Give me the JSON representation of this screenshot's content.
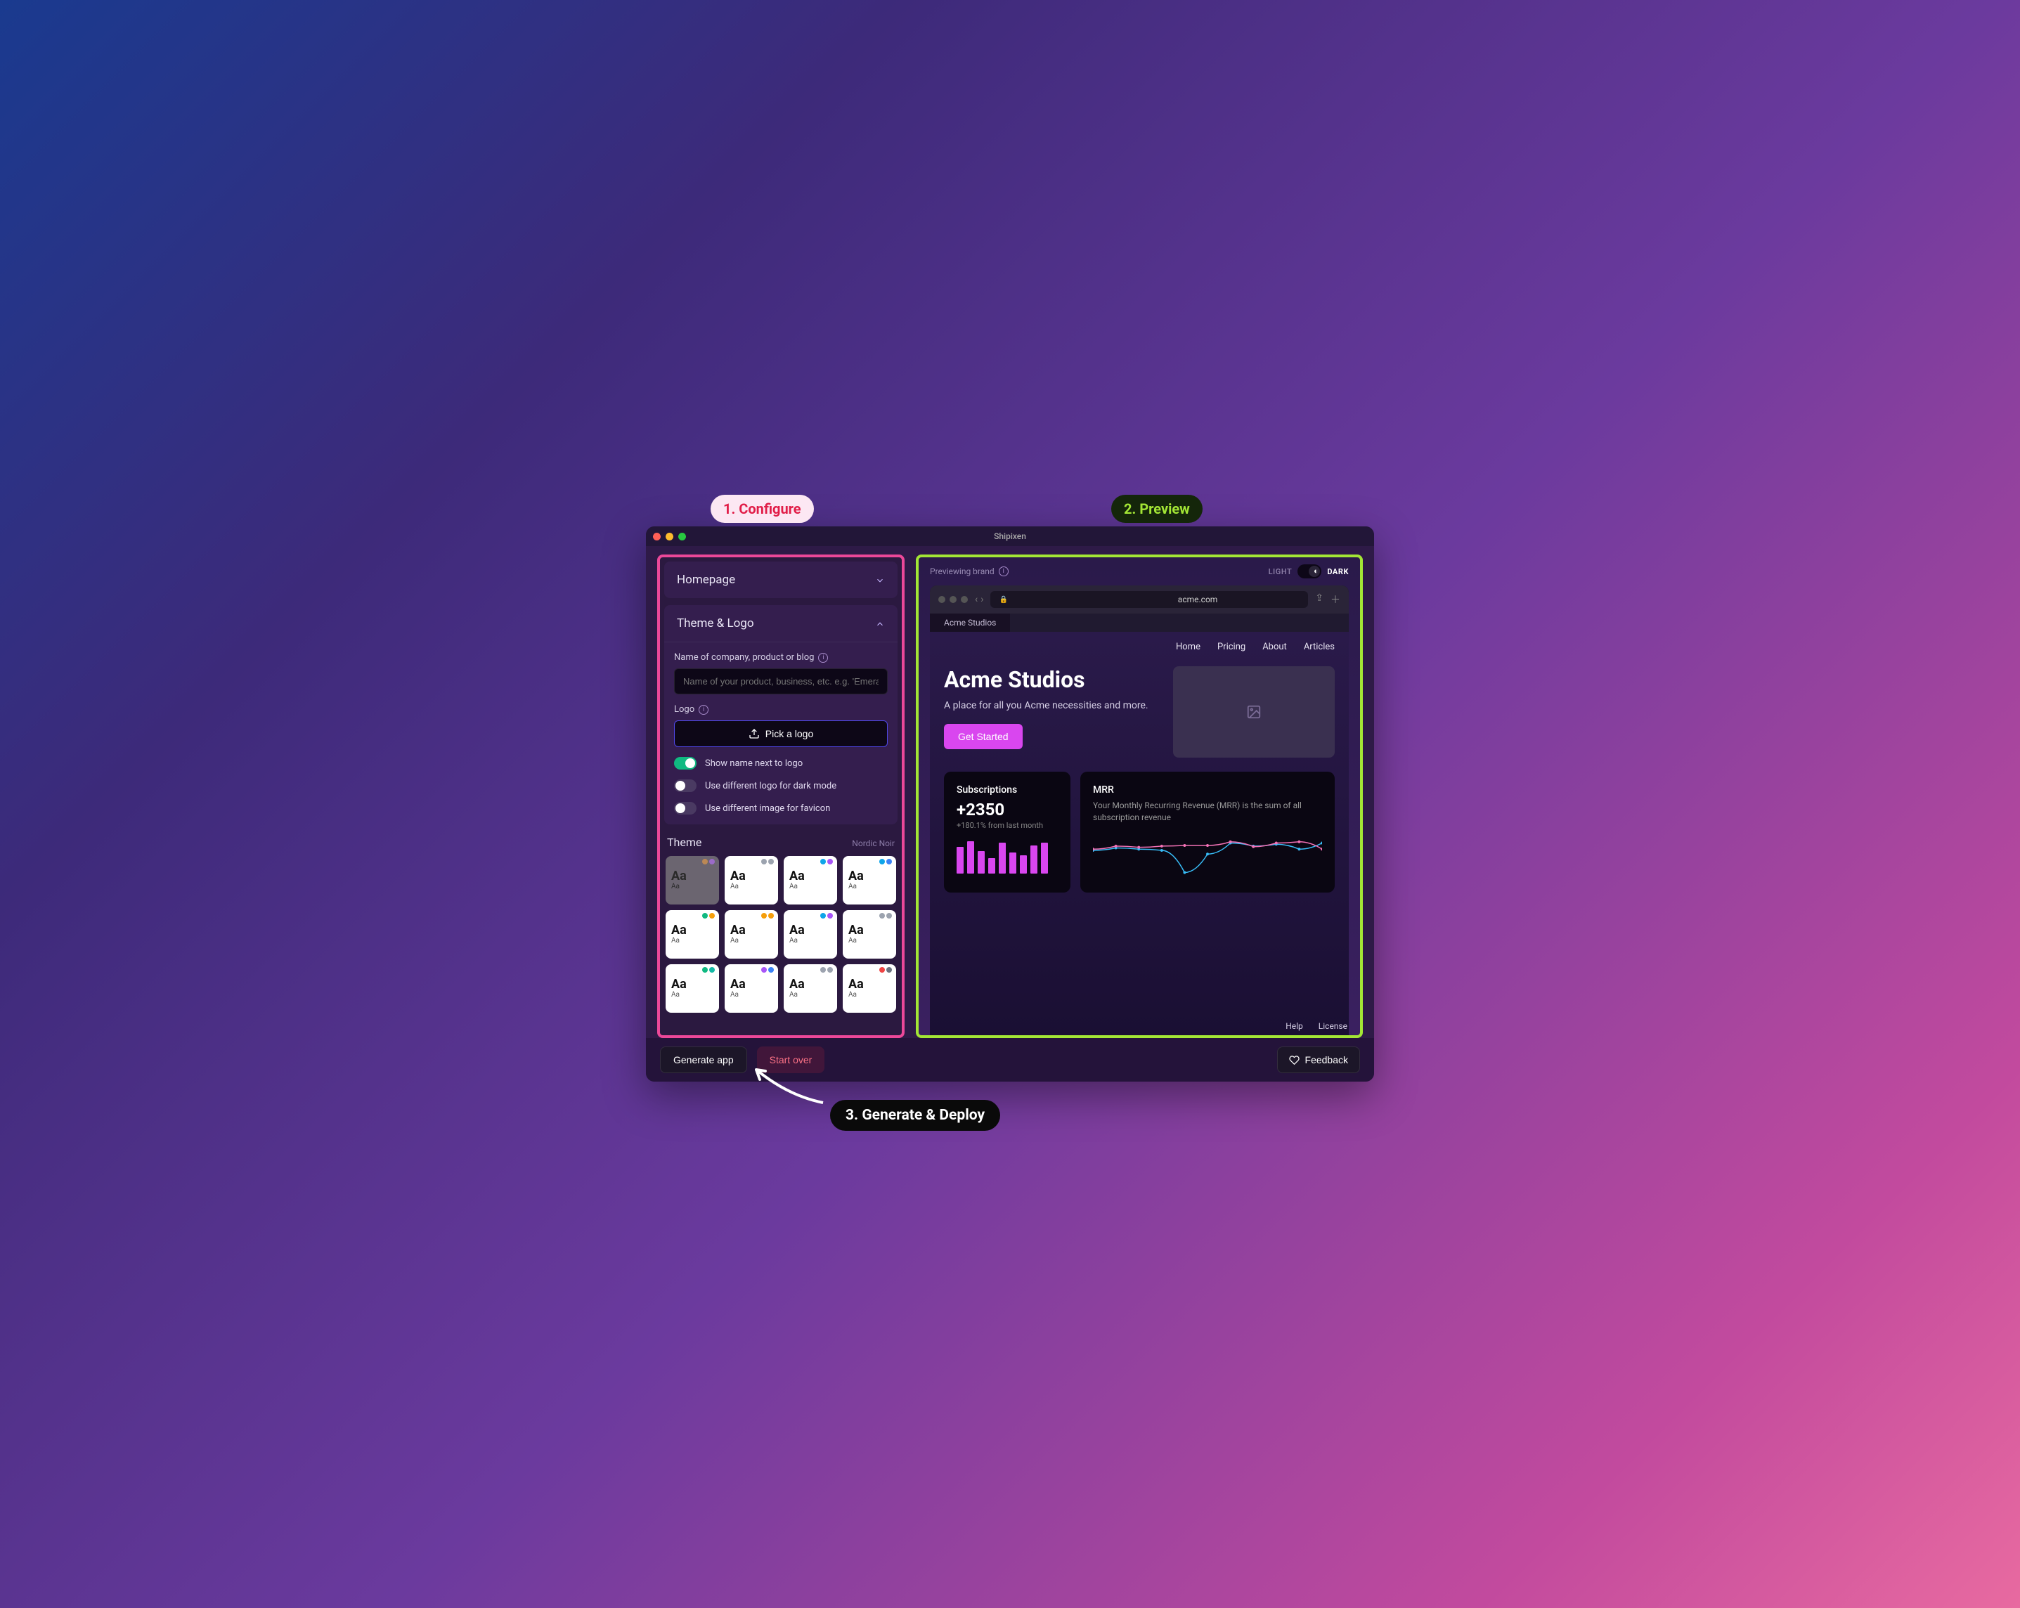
{
  "annotations": {
    "configure": "1. Configure",
    "preview": "2. Preview",
    "generate": "3. Generate & Deploy"
  },
  "titlebar": {
    "title": "Shipixen"
  },
  "left": {
    "homepage": {
      "title": "Homepage"
    },
    "themeLogo": {
      "title": "Theme & Logo",
      "nameLabel": "Name of company, product or blog",
      "namePlaceholder": "Name of your product, business, etc. e.g. 'Emera",
      "logoLabel": "Logo",
      "pickLogo": "Pick a logo",
      "toggle1": "Show name next to logo",
      "toggle2": "Use different logo for dark mode",
      "toggle3": "Use different image for favicon"
    },
    "theme": {
      "title": "Theme",
      "current": "Nordic Noir",
      "cards": [
        {
          "dots": [
            "#b85",
            "#9b6bc9"
          ],
          "selected": true
        },
        {
          "dots": [
            "#9ca3af",
            "#9ca3af"
          ]
        },
        {
          "dots": [
            "#0ea5e9",
            "#a855f7"
          ]
        },
        {
          "dots": [
            "#0ea5e9",
            "#3b82f6"
          ]
        },
        {
          "dots": [
            "#10b981",
            "#f59e0b"
          ]
        },
        {
          "dots": [
            "#f59e0b",
            "#f59e0b"
          ]
        },
        {
          "dots": [
            "#0ea5e9",
            "#a855f7"
          ]
        },
        {
          "dots": [
            "#9ca3af",
            "#9ca3af"
          ]
        },
        {
          "dots": [
            "#10b981",
            "#14b8a6"
          ]
        },
        {
          "dots": [
            "#a855f7",
            "#3b82f6"
          ]
        },
        {
          "dots": [
            "#9ca3af",
            "#9ca3af"
          ]
        },
        {
          "dots": [
            "#ef4444",
            "#6b7280"
          ]
        }
      ],
      "aaBig": "Aa",
      "aaSmall": "Aa"
    }
  },
  "right": {
    "previewing": "Previewing brand",
    "light": "LIGHT",
    "dark": "DARK",
    "url": "acme.com",
    "tab": "Acme Studios",
    "nav": [
      "Home",
      "Pricing",
      "About",
      "Articles"
    ],
    "heroTitle": "Acme Studios",
    "heroSub": "A place for all you Acme necessities and more.",
    "cta": "Get Started",
    "subs": {
      "title": "Subscriptions",
      "val": "+2350",
      "sub": "+180.1% from last month"
    },
    "mrr": {
      "title": "MRR",
      "desc": "Your Monthly Recurring Revenue (MRR) is the sum of all subscription revenue"
    },
    "footer": [
      "Help",
      "License"
    ]
  },
  "bottom": {
    "generate": "Generate app",
    "startOver": "Start over",
    "feedback": "Feedback"
  },
  "chart_data": [
    {
      "type": "bar",
      "title": "Subscriptions",
      "values": [
        38,
        46,
        32,
        22,
        44,
        30,
        26,
        40,
        44
      ],
      "ylim": [
        0,
        50
      ],
      "color": "#d946ef"
    },
    {
      "type": "line",
      "title": "MRR",
      "x": [
        0,
        1,
        2,
        3,
        4,
        5,
        6,
        7,
        8,
        9,
        10
      ],
      "series": [
        {
          "name": "blue",
          "color": "#38bdf8",
          "values": [
            48,
            52,
            50,
            48,
            12,
            42,
            60,
            55,
            58,
            50,
            60
          ]
        },
        {
          "name": "pink",
          "color": "#f472b6",
          "values": [
            50,
            55,
            53,
            55,
            56,
            56,
            62,
            54,
            60,
            62,
            50
          ]
        }
      ],
      "ylim": [
        0,
        80
      ]
    }
  ]
}
